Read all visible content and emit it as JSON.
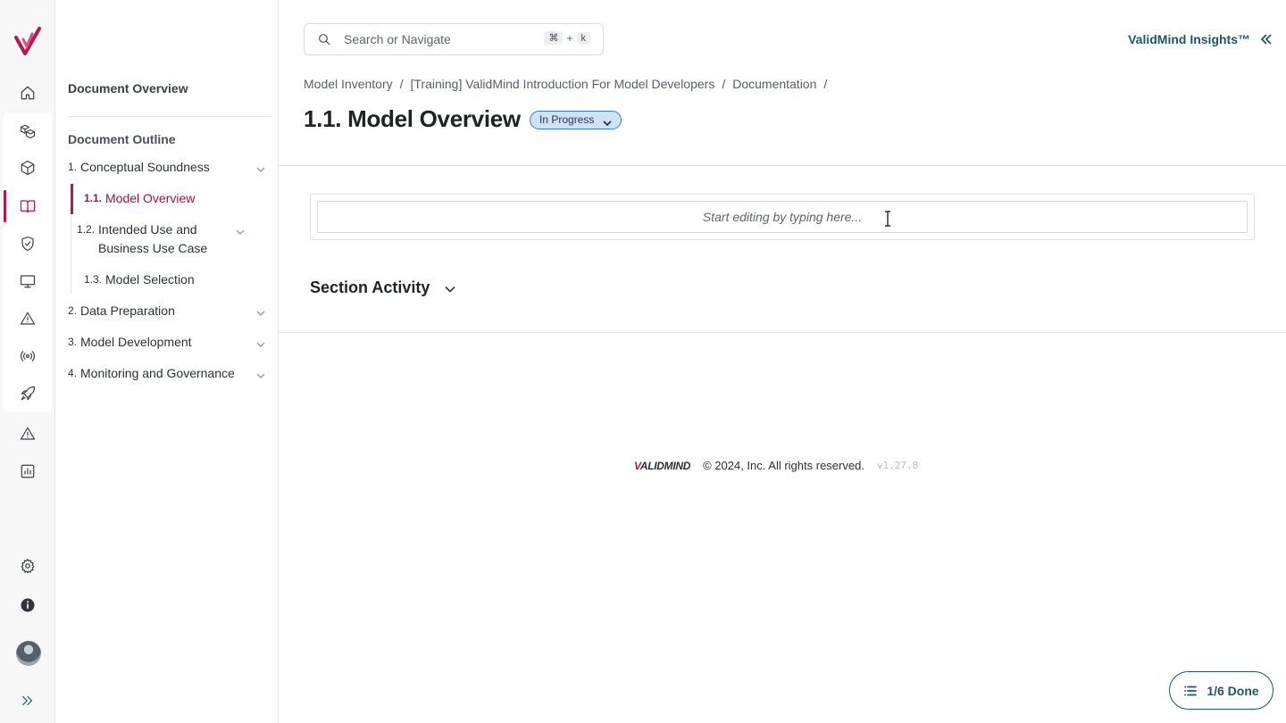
{
  "rail": {
    "items": [
      {
        "icon": "home-icon"
      },
      {
        "icon": "models-icon"
      },
      {
        "icon": "cube-icon"
      },
      {
        "icon": "book-icon"
      },
      {
        "icon": "shield-check-icon"
      },
      {
        "icon": "monitor-icon"
      },
      {
        "icon": "warning-icon"
      },
      {
        "icon": "broadcast-icon"
      },
      {
        "icon": "rocket-icon"
      },
      {
        "icon": "alert-icon"
      },
      {
        "icon": "chart-icon"
      },
      {
        "icon": "gear-icon"
      },
      {
        "icon": "info-icon"
      }
    ],
    "active_item": "book-icon"
  },
  "outline": {
    "doc_title": "Document Overview",
    "outline_title": "Document Outline",
    "items": [
      {
        "num": "1.",
        "label": "Conceptual Soundness",
        "level": 1,
        "expandable": true
      },
      {
        "num": "1.1.",
        "label": "Model Overview",
        "level": 2,
        "active": true
      },
      {
        "num": "1.2.",
        "label": "Intended Use and Business Use Case",
        "level": 2,
        "expandable": true
      },
      {
        "num": "1.3.",
        "label": "Model Selection",
        "level": 2
      },
      {
        "num": "2.",
        "label": "Data Preparation",
        "level": 1,
        "expandable": true
      },
      {
        "num": "3.",
        "label": "Model Development",
        "level": 1,
        "expandable": true
      },
      {
        "num": "4.",
        "label": "Monitoring and Governance",
        "level": 1,
        "expandable": true
      }
    ]
  },
  "search": {
    "placeholder": "Search or Navigate",
    "shortcut_mod": "⌘",
    "shortcut_plus": "+",
    "shortcut_key": "k"
  },
  "header": {
    "insights_label": "ValidMind Insights™"
  },
  "breadcrumb": {
    "items": [
      "Model Inventory",
      "/",
      "[Training] ValidMind Introduction For Model Developers",
      "/",
      "Documentation",
      "/"
    ]
  },
  "page": {
    "title": "1.1. Model Overview",
    "status": "In Progress",
    "status_color": "#cfe2f8"
  },
  "editor": {
    "placeholder": "Start editing by typing here..."
  },
  "activity": {
    "label": "Section Activity"
  },
  "footer": {
    "brand_first": "V",
    "brand_rest": "ALIDMIND",
    "copyright": "© 2024, Inc. All rights reserved.",
    "version": "v1.27.8"
  },
  "progress": {
    "label": "1/6 Done"
  },
  "colors": {
    "accent": "#b5174e",
    "teal": "#1f5566"
  }
}
